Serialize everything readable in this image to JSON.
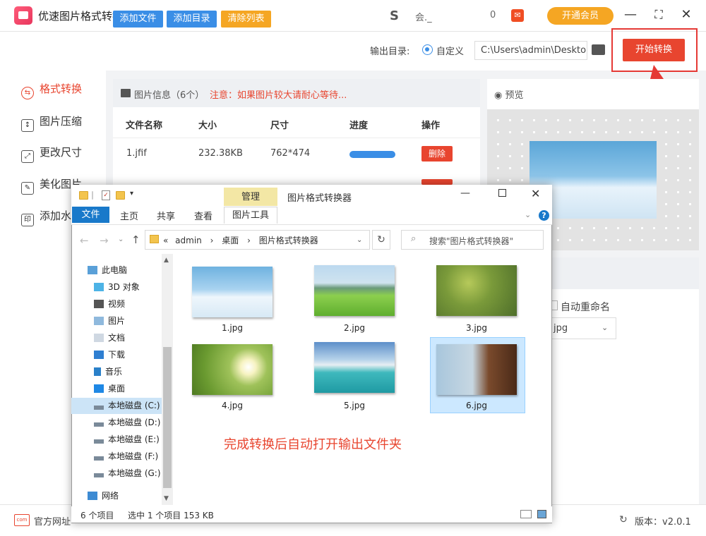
{
  "app": {
    "title": "优速图片格式转换器",
    "user_name": "会._",
    "msg_count": "0",
    "vip_label": "开通会员"
  },
  "sidebar": {
    "items": [
      {
        "label": "格式转换",
        "icon": "format-convert-icon"
      },
      {
        "label": "图片压缩",
        "icon": "compress-icon"
      },
      {
        "label": "更改尺寸",
        "icon": "resize-icon"
      },
      {
        "label": "美化图片",
        "icon": "beautify-icon"
      },
      {
        "label": "添加水",
        "icon": "watermark-icon"
      }
    ]
  },
  "toolbar": {
    "add_file": "添加文件",
    "add_dir": "添加目录",
    "clear_list": "清除列表",
    "output_label": "输出目录:",
    "radio_custom": "自定义",
    "output_path": "C:\\Users\\admin\\Deskto",
    "start_button": "开始转换"
  },
  "file_list": {
    "info_label": "图片信息（6个）",
    "warning": "注意：如果图片较大请耐心等待...",
    "headers": [
      "文件名称",
      "大小",
      "尺寸",
      "进度",
      "操作"
    ],
    "rows": [
      {
        "name": "1.jfif",
        "size": "232.38KB",
        "dims": "762*474",
        "progress": 1.0,
        "action": "删除"
      }
    ]
  },
  "preview": {
    "label": "预览"
  },
  "settings": {
    "auto_rename": "自动重命名",
    "format_value": "jpg"
  },
  "footer": {
    "site_label": "官方网址",
    "version": "版本：v2.0.1"
  },
  "explorer": {
    "tab_manage": "管理",
    "title": "图片格式转换器",
    "ribbon_tabs": [
      "文件",
      "主页",
      "共享",
      "查看"
    ],
    "ribbon_picture": "图片工具",
    "address": [
      "«",
      "admin",
      "›",
      "桌面",
      "›",
      "图片格式转换器"
    ],
    "search_placeholder": "搜索\"图片格式转换器\"",
    "nav": [
      {
        "label": "此电脑",
        "icon": "computer-icon"
      },
      {
        "label": "3D 对象",
        "icon": "3d-objects-icon"
      },
      {
        "label": "视频",
        "icon": "video-icon"
      },
      {
        "label": "图片",
        "icon": "pictures-icon"
      },
      {
        "label": "文档",
        "icon": "documents-icon"
      },
      {
        "label": "下载",
        "icon": "download-icon"
      },
      {
        "label": "音乐",
        "icon": "music-icon"
      },
      {
        "label": "桌面",
        "icon": "desktop-icon"
      },
      {
        "label": "本地磁盘 (C:)",
        "icon": "drive-icon"
      },
      {
        "label": "本地磁盘 (D:)",
        "icon": "drive-icon"
      },
      {
        "label": "本地磁盘 (E:)",
        "icon": "drive-icon"
      },
      {
        "label": "本地磁盘 (F:)",
        "icon": "drive-icon"
      },
      {
        "label": "本地磁盘 (G:)",
        "icon": "drive-icon"
      },
      {
        "label": "网络",
        "icon": "network-icon"
      }
    ],
    "files": [
      "1.jpg",
      "2.jpg",
      "3.jpg",
      "4.jpg",
      "5.jpg",
      "6.jpg"
    ],
    "selected_file": "6.jpg",
    "note": "完成转换后自动打开输出文件夹",
    "status_count": "6 个项目",
    "status_selected": "选中 1 个项目  153 KB"
  },
  "colors": {
    "accent_red": "#e8452f",
    "accent_blue": "#3a8ee6",
    "accent_orange": "#f5a623"
  }
}
